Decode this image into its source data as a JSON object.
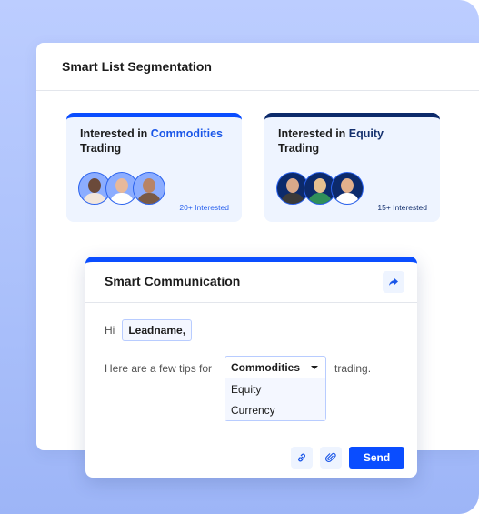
{
  "colors": {
    "accent": "#0a4dff",
    "dark_accent": "#0c2a6b",
    "background": "#bccdff"
  },
  "panel": {
    "title": "Smart List Segmentation"
  },
  "segments": [
    {
      "prefix": "Interested in ",
      "highlight": "Commodities",
      "suffix": "Trading",
      "count": "20+ Interested",
      "avatars": 3
    },
    {
      "prefix": "Interested in ",
      "highlight": "Equity",
      "suffix": "Trading",
      "count": "15+ Interested",
      "avatars": 3
    }
  ],
  "communication": {
    "title": "Smart Communication",
    "share_icon": "share-arrow-icon",
    "greeting": "Hi",
    "lead_chip": "Leadname,",
    "tip_text": "Here are a few tips for",
    "trailing_text": "trading.",
    "dropdown": {
      "selected": "Commodities",
      "options": [
        "Equity",
        "Currency"
      ]
    },
    "footer": {
      "link_icon": "link-icon",
      "attach_icon": "paperclip-icon",
      "send_label": "Send"
    }
  }
}
